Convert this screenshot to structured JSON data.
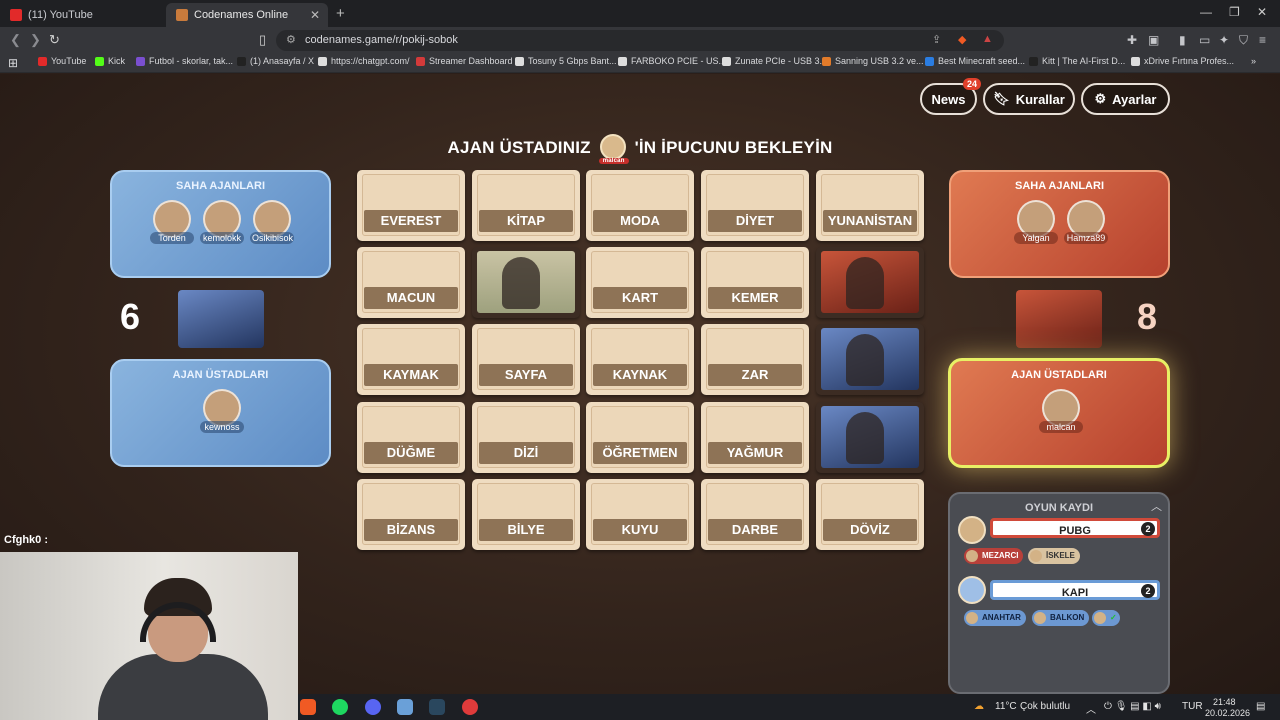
{
  "browser": {
    "tabs": [
      {
        "label": "(11) YouTube",
        "color": "#e22a2a"
      },
      {
        "label": "Codenames Online",
        "color": "#c97b3c"
      }
    ],
    "url": "codenames.game/r/pokij-sobok",
    "bookmarks": [
      {
        "label": "YouTube",
        "color": "#e22a2a"
      },
      {
        "label": "Kick",
        "color": "#53fc18"
      },
      {
        "label": "Futbol - skorlar, tak...",
        "color": "#7a4fd0"
      },
      {
        "label": "(1) Anasayfa / X",
        "color": "#222222"
      },
      {
        "label": "https://chatgpt.com/",
        "color": "#dddddd"
      },
      {
        "label": "Streamer Dashboard",
        "color": "#d33a3a"
      },
      {
        "label": "Tosuny 5 Gbps Bant...",
        "color": "#dddddd"
      },
      {
        "label": "FARBOKO PCIE - US...",
        "color": "#dddddd"
      },
      {
        "label": "Zunate PCIe - USB 3....",
        "color": "#dddddd"
      },
      {
        "label": "Sanning USB 3.2 ve...",
        "color": "#e27b2a"
      },
      {
        "label": "Best Minecraft seed...",
        "color": "#2a7de2"
      },
      {
        "label": "Kitt | The AI-First D...",
        "color": "#222222"
      },
      {
        "label": "xDrive Fırtına Profes...",
        "color": "#dddddd"
      }
    ]
  },
  "header": {
    "news_label": "News",
    "news_badge": "24",
    "rules_label": "Kurallar",
    "settings_label": "Ayarlar"
  },
  "banner": {
    "before": "AJAN ÜSTADINIZ",
    "avatar_name": "malcan",
    "after": "'İN İPUCUNU BEKLEYİN"
  },
  "blue_team": {
    "field_title": "SAHA AJANLARI",
    "field_agents": [
      "Torden",
      "kemolokk",
      "Osikibisok"
    ],
    "spymaster_title": "AJAN ÜSTADLARI",
    "spymasters": [
      "kewnoss"
    ],
    "score": "6",
    "color": "#5d8cc5"
  },
  "red_team": {
    "field_title": "SAHA AJANLARI",
    "field_agents": [
      "Yalgan",
      "Hamza89"
    ],
    "spymaster_title": "AJAN ÜSTADLARI",
    "spymasters": [
      "malcan"
    ],
    "score": "8",
    "color": "#b6412d"
  },
  "board": [
    [
      "EVEREST",
      "KİTAP",
      "MODA",
      "DİYET",
      "YUNANİSTAN"
    ],
    [
      "MACUN",
      "",
      "KART",
      "KEMER",
      ""
    ],
    [
      "KAYMAK",
      "SAYFA",
      "KAYNAK",
      "ZAR",
      ""
    ],
    [
      "DÜĞME",
      "DİZİ",
      "ÖĞRETMEN",
      "YAĞMUR",
      ""
    ],
    [
      "BİZANS",
      "BİLYE",
      "KUYU",
      "DARBE",
      "DÖVİZ"
    ]
  ],
  "revealed": {
    "r1c1": "civilian",
    "r1c4": "red",
    "r2c4": "blue",
    "r3c4": "blue"
  },
  "game_log": {
    "title": "OYUN KAYDI",
    "entries": [
      {
        "team": "red",
        "clue": "PUBG",
        "number": "2",
        "guesses": [
          {
            "word": "MEZARCI",
            "color": "red"
          },
          {
            "word": "İSKELE",
            "color": "beige"
          }
        ]
      },
      {
        "team": "blue",
        "clue": "KAPI",
        "number": "2",
        "guesses": [
          {
            "word": "ANAHTAR",
            "color": "blue"
          },
          {
            "word": "BALKON",
            "color": "blue"
          },
          {
            "word": "✓",
            "color": "blue"
          }
        ]
      }
    ]
  },
  "chat_line": "Cfghk0 :",
  "taskbar": {
    "weather_temp": "11°C",
    "weather_text": "Çok bulutlu",
    "lang": "TUR",
    "time": "21:48",
    "date": "20.02.2026"
  }
}
